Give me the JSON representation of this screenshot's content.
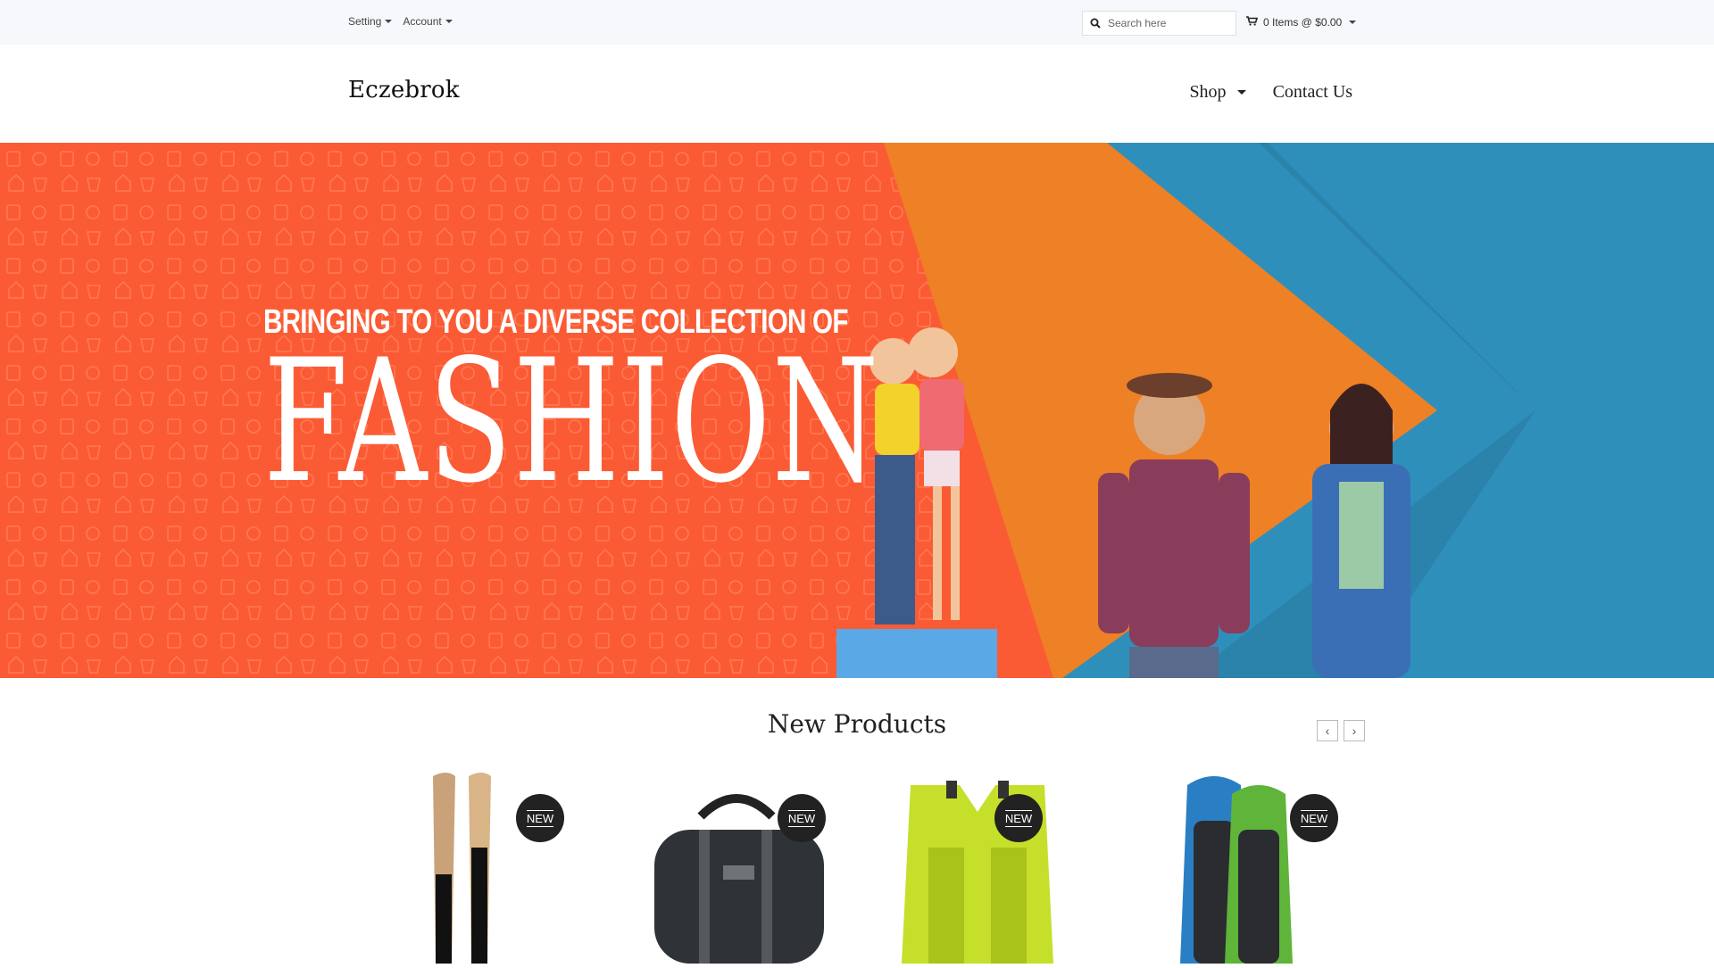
{
  "topbar": {
    "setting_label": "Setting",
    "account_label": "Account",
    "search_placeholder": "Search here",
    "cart_label": "0 Items @ $0.00"
  },
  "header": {
    "logo": "Eczebrok",
    "nav": {
      "shop": "Shop",
      "contact": "Contact Us"
    }
  },
  "banner": {
    "line1": "BRINGING TO YOU A DIVERSE COLLECTION OF",
    "line2": "FASHION",
    "colors": {
      "orange": "#fb5b34",
      "amber": "#ee8026",
      "blue": "#2f8fbb",
      "dark_blue": "#2a7aa0"
    }
  },
  "new_products": {
    "title": "New Products",
    "prev_icon": "chevron-left-icon",
    "next_icon": "chevron-right-icon",
    "items": [
      {
        "name": "water ski",
        "badge": "NEW"
      },
      {
        "name": "duffel bag",
        "badge": "NEW"
      },
      {
        "name": "life vest",
        "badge": "NEW"
      },
      {
        "name": "paddle board",
        "badge": "NEW"
      }
    ]
  }
}
